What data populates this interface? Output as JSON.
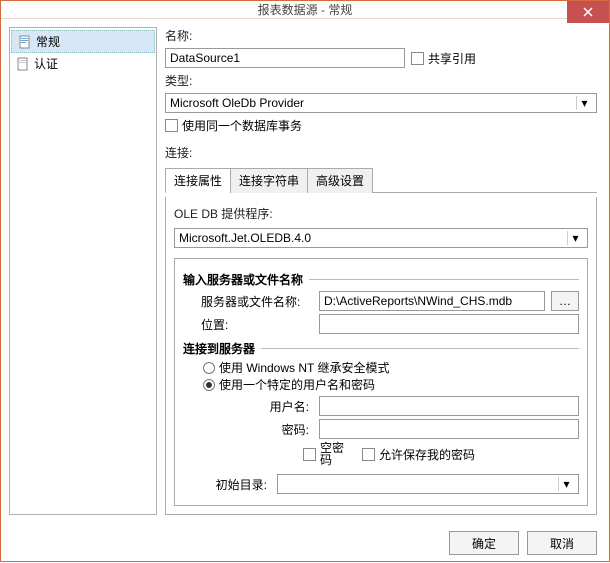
{
  "title": "报表数据源 - 常规",
  "sidebar": {
    "items": [
      {
        "label": "常规"
      },
      {
        "label": "认证"
      }
    ]
  },
  "main": {
    "name_label": "名称:",
    "name_value": "DataSource1",
    "share_ref_label": "共享引用",
    "type_label": "类型:",
    "type_value": "Microsoft OleDb Provider",
    "same_trans_label": "使用同一个数据库事务",
    "conn_label": "连接:",
    "tabs": [
      {
        "label": "连接属性"
      },
      {
        "label": "连接字符串"
      },
      {
        "label": "高级设置"
      }
    ],
    "oledb_label": "OLE DB 提供程序:",
    "oledb_value": "Microsoft.Jet.OLEDB.4.0",
    "server_section": "输入服务器或文件名称",
    "server_label": "服务器或文件名称:",
    "server_value": "D:\\ActiveReports\\NWind_CHS.mdb",
    "location_label": "位置:",
    "location_value": "",
    "connect_section": "连接到服务器",
    "radio_nt": "使用 Windows NT 继承安全模式",
    "radio_specific": "使用一个特定的用户名和密码",
    "username_label": "用户名:",
    "username_value": "",
    "password_label": "密码:",
    "password_value": "",
    "blank_pwd_label": "空密码",
    "allow_save_label": "允许保存我的密码",
    "initdir_label": "初始目录:",
    "initdir_value": ""
  },
  "footer": {
    "ok": "确定",
    "cancel": "取消"
  }
}
